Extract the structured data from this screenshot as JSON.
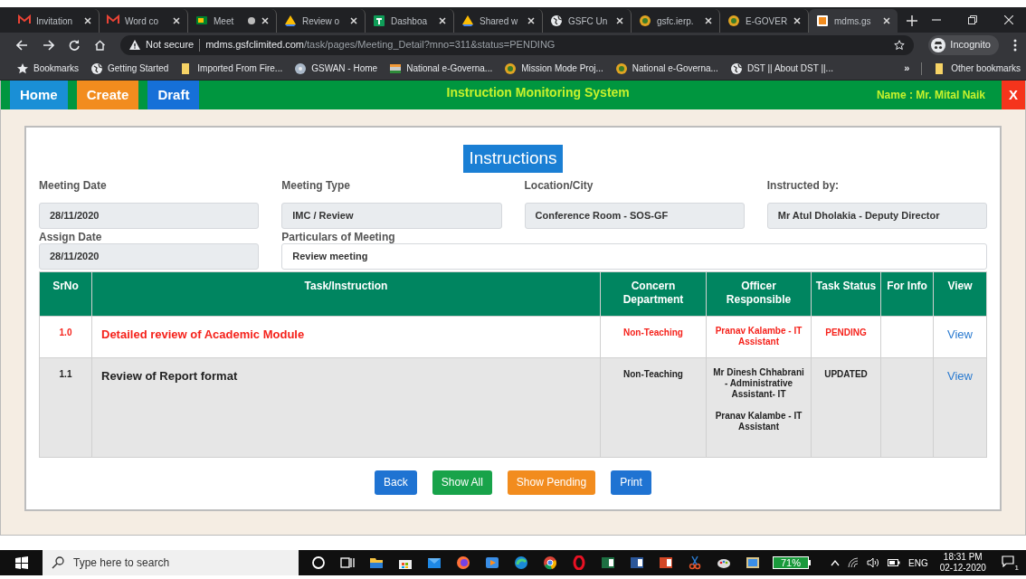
{
  "browser": {
    "tabs": [
      {
        "title": "Invitation",
        "kind": "gmail",
        "selected": false
      },
      {
        "title": "Word co",
        "kind": "gmail",
        "selected": false
      },
      {
        "title": "Meet",
        "kind": "meet",
        "selected": false,
        "recording": true
      },
      {
        "title": "Review o",
        "kind": "drive",
        "selected": false
      },
      {
        "title": "Dashboa",
        "kind": "sheets",
        "selected": false
      },
      {
        "title": "Shared w",
        "kind": "drive",
        "selected": false
      },
      {
        "title": "GSFC Un",
        "kind": "globe",
        "selected": false
      },
      {
        "title": "gsfc.ierp.",
        "kind": "emblem",
        "selected": false
      },
      {
        "title": "E-GOVER",
        "kind": "emblem",
        "selected": false
      },
      {
        "title": "mdms.gs",
        "kind": "orange",
        "selected": true
      }
    ],
    "security": "Not secure",
    "url_host": "mdms.gsfclimited.com",
    "url_path": "/task/pages/Meeting_Detail?mno=311&status=PENDING",
    "profile": "Incognito",
    "bookmarks": [
      {
        "label": "Bookmarks",
        "kind": "star"
      },
      {
        "label": "Getting Started",
        "kind": "globe"
      },
      {
        "label": "Imported From Fire...",
        "kind": "folder"
      },
      {
        "label": "GSWAN - Home",
        "kind": "disc"
      },
      {
        "label": "National e-Governa...",
        "kind": "flag"
      },
      {
        "label": "Mission Mode Proj...",
        "kind": "emblem"
      },
      {
        "label": "National e-Governa...",
        "kind": "emblem"
      },
      {
        "label": "DST || About DST ||...",
        "kind": "globe"
      }
    ],
    "more": "»",
    "other_bookmarks": "Other bookmarks"
  },
  "nav": {
    "buttons": [
      {
        "label": "Home",
        "color": "#1a8fd6"
      },
      {
        "label": "Create",
        "color": "#f28c1e"
      },
      {
        "label": "Draft",
        "color": "#1670d8"
      }
    ],
    "title": "Instruction Monitoring System",
    "user": "Name : Mr. Mital Naik",
    "close": "X"
  },
  "heading": "Instructions",
  "fields": [
    {
      "label": "Meeting Date",
      "value": "28/11/2020",
      "readonly": true
    },
    {
      "label": "Meeting Type",
      "value": "IMC / Review",
      "readonly": true
    },
    {
      "label": "Location/City",
      "value": "Conference Room - SOS-GF",
      "readonly": true
    },
    {
      "label": "Instructed by:",
      "value": "Mr Atul Dholakia - Deputy Director",
      "readonly": true
    },
    {
      "label": "Assign Date",
      "value": "28/11/2020",
      "readonly": true
    },
    {
      "label": "Particulars of Meeting",
      "value": "Review meeting",
      "readonly": false
    }
  ],
  "table": {
    "columns": [
      "SrNo",
      "Task/Instruction",
      "Concern Department",
      "Officer Responsible",
      "Task Status",
      "For Info",
      "View"
    ],
    "rows": [
      {
        "kind": "pending",
        "srno": "1.0",
        "task": "Detailed review of Academic Module",
        "department": "Non-Teaching",
        "officers": [
          "Pranav Kalambe - IT Assistant"
        ],
        "status": "PENDING",
        "view": "View"
      },
      {
        "kind": "updated",
        "srno": "1.1",
        "task": "Review of Report format",
        "department": "Non-Teaching",
        "officers": [
          "Mr Dinesh Chhabrani - Administrative Assistant- IT",
          "Pranav Kalambe - IT Assistant"
        ],
        "status": "UPDATED",
        "view": "View"
      }
    ]
  },
  "actions": [
    {
      "label": "Back",
      "color": "#1f73d2"
    },
    {
      "label": "Show All",
      "color": "#18a34a"
    },
    {
      "label": "Show Pending",
      "color": "#f28c1e"
    },
    {
      "label": "Print",
      "color": "#1f73d2"
    }
  ],
  "taskbar": {
    "search_placeholder": "Type here to search",
    "battery": "71%",
    "language": "ENG",
    "time": "18:31 PM",
    "date": "02-12-2020",
    "notifications": "1"
  }
}
